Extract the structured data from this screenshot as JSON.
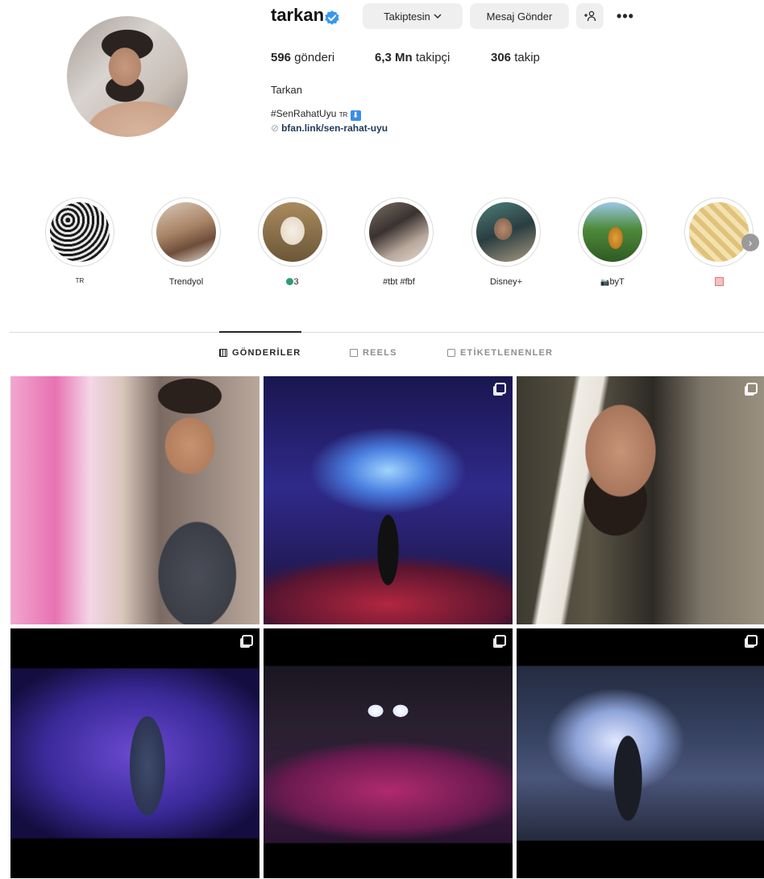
{
  "profile": {
    "username": "tarkan",
    "full_name": "Tarkan",
    "bio_line": "#SenRahatUyu",
    "bio_suffix": "TR",
    "link": "bfan.link/sen-rahat-uyu"
  },
  "actions": {
    "follow_label": "Takiptesin",
    "message_label": "Mesaj Gönder",
    "suggest_label": "+α",
    "more_label": "•••"
  },
  "stats": {
    "posts_count": "596",
    "posts_label": "gönderi",
    "followers_count": "6,3 Mn",
    "followers_label": "takipçi",
    "following_count": "306",
    "following_label": "takip"
  },
  "highlights": [
    {
      "label": "TR"
    },
    {
      "label": "Trendyol"
    },
    {
      "label": "3",
      "prefix_icon": "green-circle-icon"
    },
    {
      "label": "#tbt #fbf"
    },
    {
      "label": "Disney+"
    },
    {
      "label": "byT",
      "prefix_icon": "camera-icon"
    },
    {
      "label": "",
      "prefix_icon": "sticker-icon"
    }
  ],
  "tabs": [
    {
      "label": "GÖNDERİLER",
      "active": true
    },
    {
      "label": "REELS",
      "active": false
    },
    {
      "label": "ETİKETLENENLER",
      "active": false
    }
  ],
  "colors": {
    "verified": "#3897f0",
    "button_bg": "#efefef",
    "divider": "#dbdbdb"
  }
}
